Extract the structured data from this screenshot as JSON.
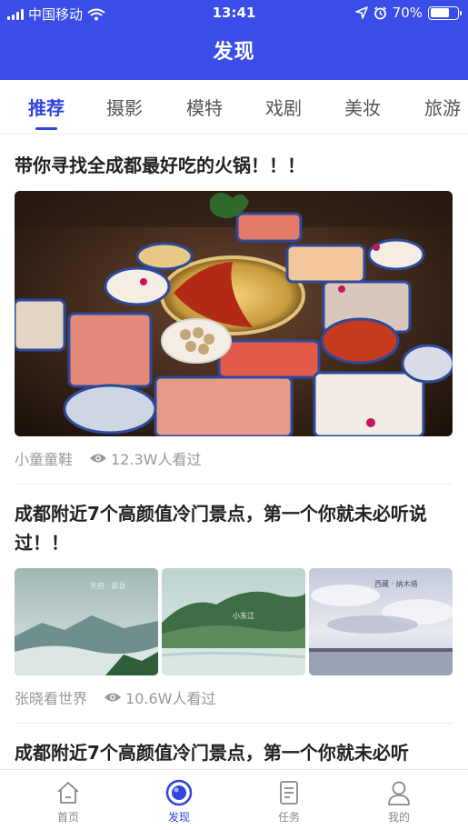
{
  "status_bar": {
    "carrier": "中国移动",
    "time": "13:41",
    "battery": "70%",
    "battery_level": 0.7,
    "icons": [
      "signal-icon",
      "wifi-icon",
      "location-icon",
      "alarm-icon",
      "battery-icon"
    ]
  },
  "header": {
    "title": "发现"
  },
  "tabs": [
    {
      "label": "推荐",
      "active": true
    },
    {
      "label": "摄影"
    },
    {
      "label": "模特"
    },
    {
      "label": "戏剧"
    },
    {
      "label": "美妆"
    },
    {
      "label": "旅游"
    }
  ],
  "posts": [
    {
      "title": "带你寻找全成都最好吃的火锅！！！",
      "author": "小童童鞋",
      "views": "12.3W人看过"
    },
    {
      "title": "成都附近7个高颜值冷门景点，第一个你就未必听说过！！",
      "author": "张晓看世界",
      "views": "10.6W人看过",
      "image_captions": [
        "天府 · 歙县",
        "小东江",
        "西藏 · 纳木措"
      ]
    },
    {
      "title": "成都附近7个高颜值冷门景点，第一个你就未必听"
    }
  ],
  "tabbar": [
    {
      "label": "首页",
      "icon": "home-icon"
    },
    {
      "label": "发现",
      "icon": "discover-icon",
      "active": true
    },
    {
      "label": "任务",
      "icon": "task-icon"
    },
    {
      "label": "我的",
      "icon": "profile-icon"
    }
  ],
  "colors": {
    "brand": "#3a4de8",
    "active_tab": "#2f44e0",
    "muted": "#999999"
  }
}
